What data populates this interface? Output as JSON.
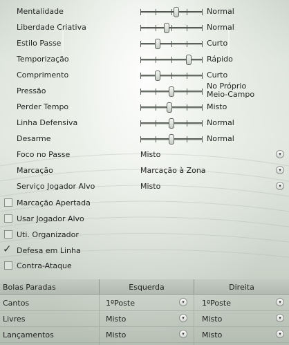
{
  "sliders": [
    {
      "label": "Mentalidade",
      "value": "Normal",
      "level": 0.58
    },
    {
      "label": "Liberdade Criativa",
      "value": "Normal",
      "level": 0.42
    },
    {
      "label": "Estilo Passe",
      "value": "Curto",
      "level": 0.28
    },
    {
      "label": "Temporização",
      "value": "Rápido",
      "level": 0.78
    },
    {
      "label": "Comprimento",
      "value": "Curto",
      "level": 0.28
    },
    {
      "label": "Pressão",
      "value": "No Próprio Meio-Campo",
      "level": 0.5
    },
    {
      "label": "Perder Tempo",
      "value": "Misto",
      "level": 0.47
    },
    {
      "label": "Linha Defensiva",
      "value": "Normal",
      "level": 0.5
    },
    {
      "label": "Desarme",
      "value": "Normal",
      "level": 0.5
    }
  ],
  "dropdowns": [
    {
      "label": "Foco no Passe",
      "value": "Misto"
    },
    {
      "label": "Marcação",
      "value": "Marcação à Zona"
    },
    {
      "label": "Serviço Jogador Alvo",
      "value": "Misto"
    }
  ],
  "checkboxes": [
    {
      "label": "Marcação Apertada",
      "checked": false
    },
    {
      "label": "Usar Jogador Alvo",
      "checked": false
    },
    {
      "label": "Uti. Organizador",
      "checked": false
    },
    {
      "label": "Defesa em Linha",
      "checked": true
    },
    {
      "label": "Contra-Ataque",
      "checked": false
    }
  ],
  "check_glyph": "✓",
  "dropdown_glyph": "▾",
  "set_pieces": {
    "headers": [
      "Bolas Paradas",
      "Esquerda",
      "Direita"
    ],
    "rows": [
      {
        "label": "Cantos",
        "left": "1ºPoste",
        "right": "1ºPoste"
      },
      {
        "label": "Livres",
        "left": "Misto",
        "right": "Misto"
      },
      {
        "label": "Lançamentos",
        "left": "Misto",
        "right": "Misto"
      }
    ]
  }
}
